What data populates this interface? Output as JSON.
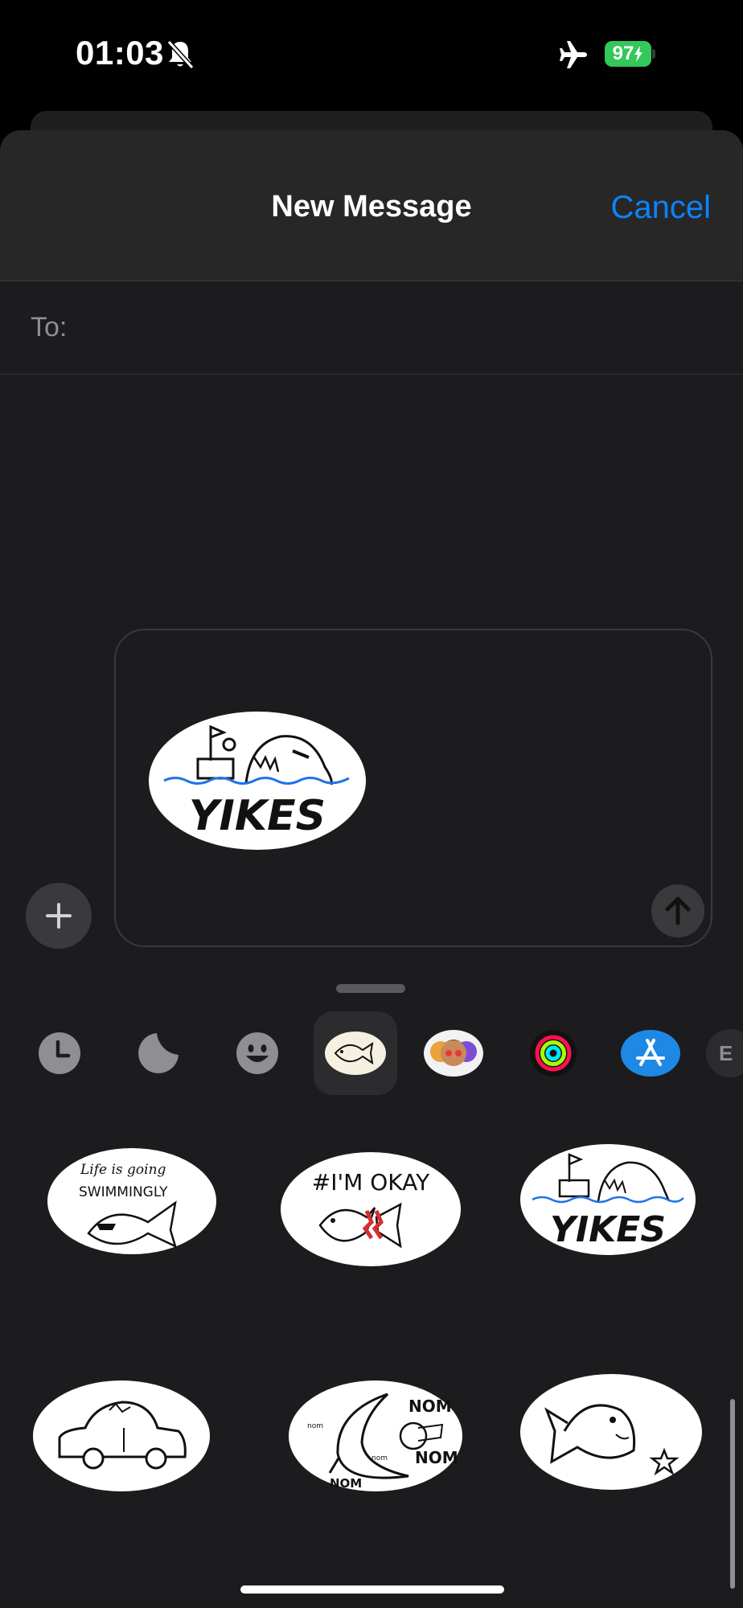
{
  "status_bar": {
    "time": "01:03",
    "battery": "97"
  },
  "header": {
    "title": "New Message",
    "cancel_label": "Cancel"
  },
  "recipient": {
    "to_label": "To:"
  },
  "compose": {
    "attached_sticker": "YIKES"
  },
  "app_drawer": {
    "apps": [
      {
        "name": "recents-icon"
      },
      {
        "name": "moon-sticker-icon"
      },
      {
        "name": "emoji-icon"
      },
      {
        "name": "fish-sticker-pack-icon",
        "selected": true
      },
      {
        "name": "memoji-icon"
      },
      {
        "name": "activity-icon"
      },
      {
        "name": "app-store-icon"
      },
      {
        "name": "more-apps-icon"
      }
    ],
    "more_label": "E"
  },
  "stickers": {
    "swimmingly": {
      "line1": "Life is going",
      "line2": "SWIMMINGLY"
    },
    "okay": {
      "text": "#I'M OKAY"
    },
    "yikes": {
      "text": "YIKES"
    },
    "nom": {
      "big1": "NOM",
      "big2": "NOM",
      "big3": "NOM",
      "small": "nom"
    }
  },
  "colors": {
    "accent": "#0a84ff",
    "battery": "#34c759",
    "background": "#1c1c1e"
  }
}
